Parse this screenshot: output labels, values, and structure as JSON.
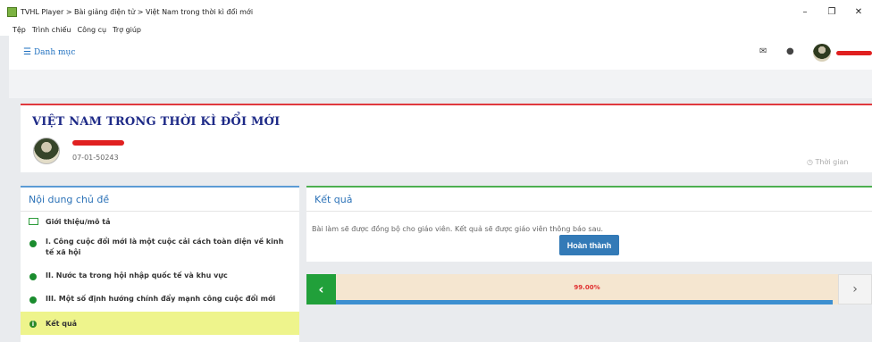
{
  "window": {
    "title": "TVHL Player > Bài giảng điện tử > Việt Nam trong thời kì đổi mới",
    "controls": {
      "minimize": "–",
      "restore": "❐",
      "close": "✕"
    }
  },
  "menu": [
    "Tệp",
    "Trình chiếu",
    "Công cụ",
    "Trợ giúp"
  ],
  "header": {
    "menu_label": "Danh mục",
    "mail_icon": "mail-icon",
    "globe_icon": "globe-icon"
  },
  "lesson": {
    "title": "VIỆT NAM TRONG THỜI KÌ ĐỔI MỚI",
    "author_code": "07-01-50243",
    "time_label": "Thời gian"
  },
  "topics": {
    "heading": "Nội dung chủ đề",
    "items": [
      "Giới thiệu/mô tả",
      "I. Công cuộc đổi mới là một cuộc cải cách toàn diện về kinh tế xã hội",
      "II. Nước ta trong hội nhập quốc tế và khu vực",
      "III. Một số định hướng chính đẩy mạnh công cuộc đổi mới",
      "Kết quả"
    ]
  },
  "result": {
    "heading": "Kết quả",
    "message": "Bài làm sẽ được đồng bộ cho giáo viên. Kết quả sẽ được giáo viên thông báo sau.",
    "done_label": "Hoàn thành"
  },
  "progress": {
    "percent_label": "99.00%",
    "percent": 99,
    "prev": "‹",
    "next": "›"
  },
  "colors": {
    "accent_blue": "#337ab7",
    "green": "#21a03a",
    "red": "#e02020",
    "highlight": "#eef48c"
  }
}
